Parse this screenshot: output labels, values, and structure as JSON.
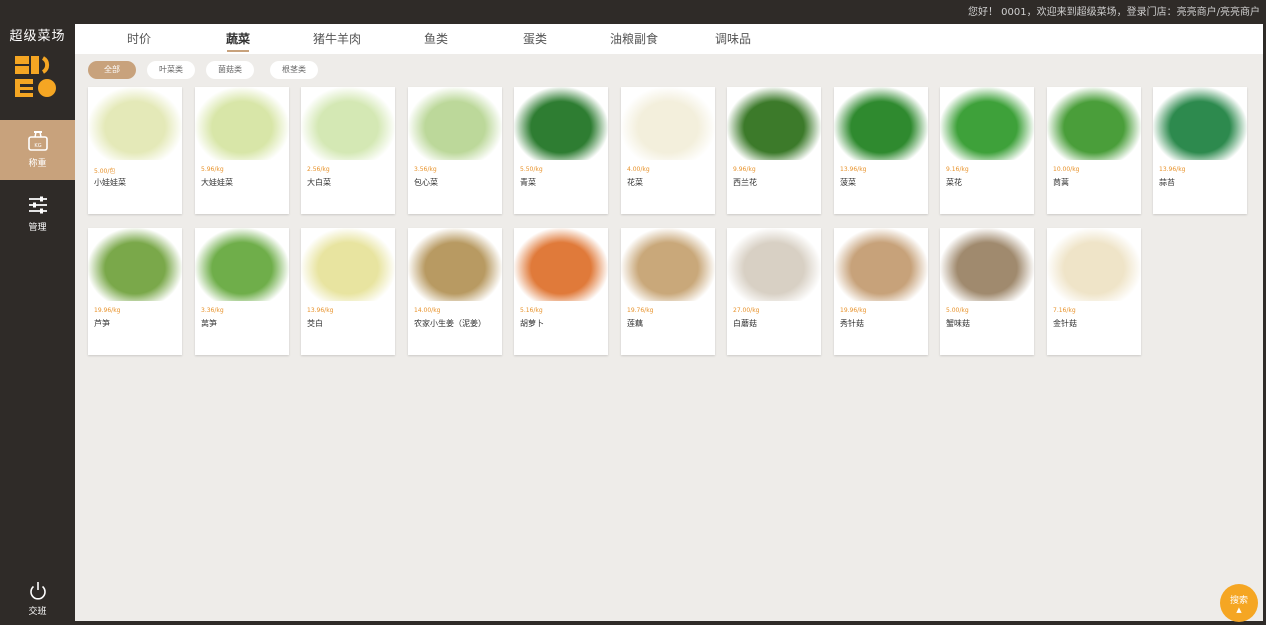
{
  "header": {
    "greeting": "您好！ 0001，欢迎来到超级菜场，登录门店：亮亮商户/亮亮商户"
  },
  "sidebar": {
    "brand": "超级菜场",
    "items": [
      {
        "label": "称重",
        "icon": "scale-icon",
        "active": true
      },
      {
        "label": "管理",
        "icon": "sliders-icon",
        "active": false
      }
    ],
    "logout": {
      "label": "交班",
      "icon": "power-icon"
    }
  },
  "tabs": [
    {
      "label": "时价",
      "active": false
    },
    {
      "label": "蔬菜",
      "active": true
    },
    {
      "label": "猪牛羊肉",
      "active": false
    },
    {
      "label": "鱼类",
      "active": false
    },
    {
      "label": "蛋类",
      "active": false
    },
    {
      "label": "油粮副食",
      "active": false
    },
    {
      "label": "调味品",
      "active": false
    }
  ],
  "subtabs": [
    {
      "label": "全部",
      "active": true
    },
    {
      "label": "叶菜类",
      "active": false
    },
    {
      "label": "菌菇类",
      "active": false
    },
    {
      "label": "根茎类",
      "active": false
    }
  ],
  "products": [
    {
      "name": "小娃娃菜",
      "price": "5.00/包",
      "icon": "baby-cabbage-pack-image",
      "color": "#e4e9b8"
    },
    {
      "name": "大娃娃菜",
      "price": "5.96/kg",
      "icon": "baby-cabbage-image",
      "color": "#d8e6a8"
    },
    {
      "name": "大白菜",
      "price": "2.56/kg",
      "icon": "napa-cabbage-image",
      "color": "#d4e8b4"
    },
    {
      "name": "包心菜",
      "price": "3.56/kg",
      "icon": "cabbage-image",
      "color": "#bcd89a"
    },
    {
      "name": "青菜",
      "price": "5.50/kg",
      "icon": "bok-choy-image",
      "color": "#2e7d32"
    },
    {
      "name": "花菜",
      "price": "4.00/kg",
      "icon": "cauliflower-image",
      "color": "#f3efdc"
    },
    {
      "name": "西兰花",
      "price": "9.96/kg",
      "icon": "broccoli-image",
      "color": "#3c7a2a"
    },
    {
      "name": "菠菜",
      "price": "13.96/kg",
      "icon": "spinach-image",
      "color": "#2f8a2f"
    },
    {
      "name": "菜花",
      "price": "9.16/kg",
      "icon": "choy-sum-image",
      "color": "#3ea13a"
    },
    {
      "name": "茼蒿",
      "price": "10.00/kg",
      "icon": "crown-daisy-image",
      "color": "#4a9e3a"
    },
    {
      "name": "蒜苔",
      "price": "13.96/kg",
      "icon": "garlic-shoots-image",
      "color": "#2d8a4e"
    },
    {
      "name": "芦笋",
      "price": "19.96/kg",
      "icon": "asparagus-image",
      "color": "#7aa84a"
    },
    {
      "name": "莴笋",
      "price": "3.36/kg",
      "icon": "stem-lettuce-image",
      "color": "#6fae4a"
    },
    {
      "name": "茭白",
      "price": "13.96/kg",
      "icon": "water-bamboo-image",
      "color": "#e8e4a0"
    },
    {
      "name": "农家小生姜（泥姜）",
      "price": "14.00/kg",
      "icon": "ginger-image",
      "color": "#b89a62"
    },
    {
      "name": "胡萝卜",
      "price": "5.16/kg",
      "icon": "carrot-image",
      "color": "#e07a3a"
    },
    {
      "name": "莲藕",
      "price": "19.76/kg",
      "icon": "lotus-root-image",
      "color": "#c9a87a"
    },
    {
      "name": "白蘑菇",
      "price": "27.00/kg",
      "icon": "white-mushroom-image",
      "color": "#d8d0c4"
    },
    {
      "name": "秀针菇",
      "price": "19.96/kg",
      "icon": "oyster-mushroom-image",
      "color": "#c7a27a"
    },
    {
      "name": "蟹味菇",
      "price": "5.00/kg",
      "icon": "crab-mushroom-image",
      "color": "#a08a6e"
    },
    {
      "name": "金针菇",
      "price": "7.16/kg",
      "icon": "enoki-image",
      "color": "#efe4c8"
    }
  ],
  "search_button": {
    "label": "搜索"
  }
}
